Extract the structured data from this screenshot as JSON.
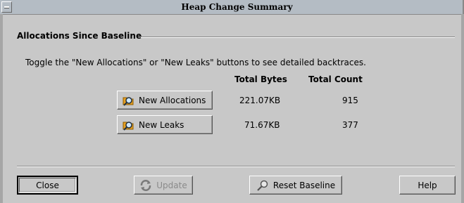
{
  "window": {
    "title": "Heap Change Summary"
  },
  "section": {
    "heading": "Allocations Since Baseline",
    "description": "Toggle the \"New Allocations\" or \"New Leaks\" buttons to see detailed backtraces."
  },
  "table": {
    "headers": {
      "bytes": "Total Bytes",
      "count": "Total Count"
    },
    "rows": [
      {
        "label": "New Allocations",
        "bytes": "221.07KB",
        "count": "915",
        "icon": "magnify-folder-icon"
      },
      {
        "label": "New Leaks",
        "bytes": "71.67KB",
        "count": "377",
        "icon": "magnify-folder-icon"
      }
    ]
  },
  "footer": {
    "close": "Close",
    "update": "Update",
    "reset": "Reset Baseline",
    "help": "Help"
  }
}
